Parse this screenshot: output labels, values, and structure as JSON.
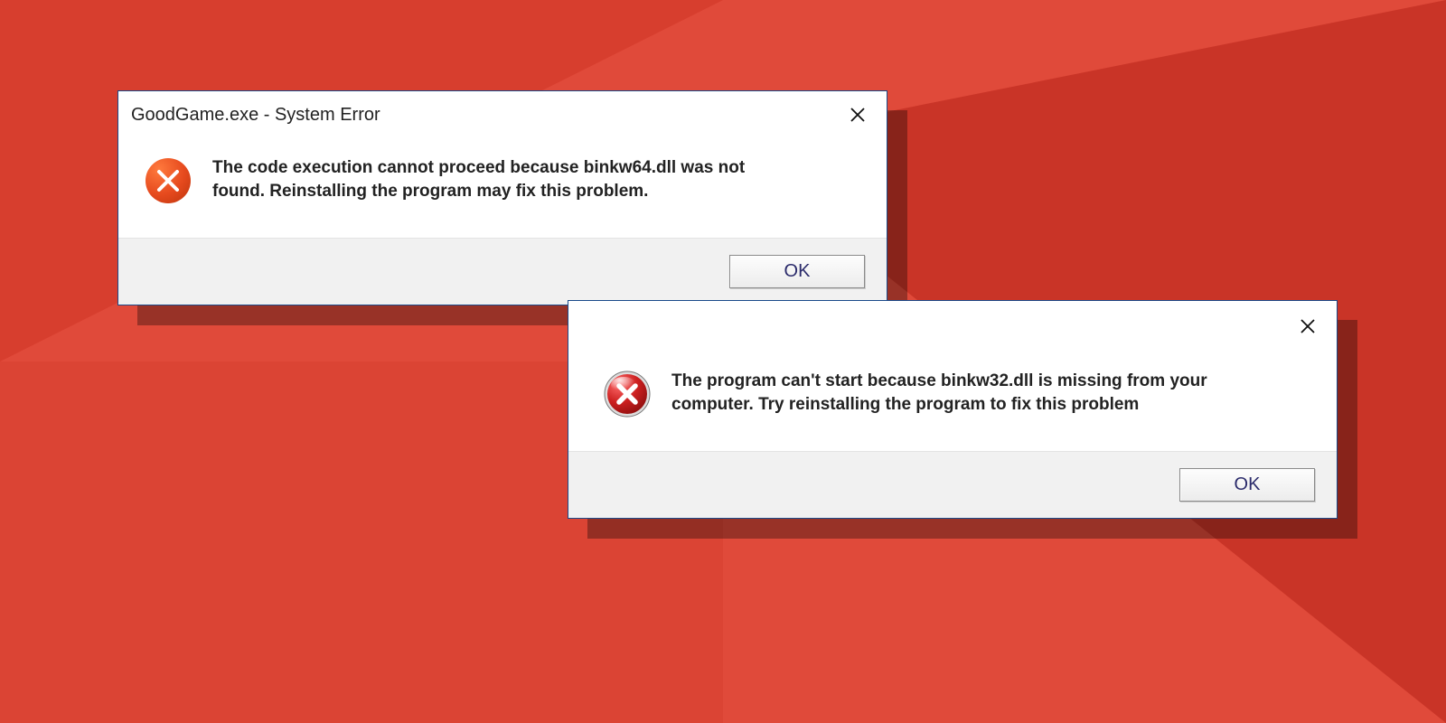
{
  "dialog1": {
    "title": "GoodGame.exe - System Error",
    "message": "The code execution cannot proceed because binkw64.dll was not found. Reinstalling the program may fix this problem.",
    "ok_label": "OK"
  },
  "dialog2": {
    "title": "",
    "message": "The program can't start because binkw32.dll is missing from your computer. Try reinstalling the program to fix this problem",
    "ok_label": "OK"
  }
}
